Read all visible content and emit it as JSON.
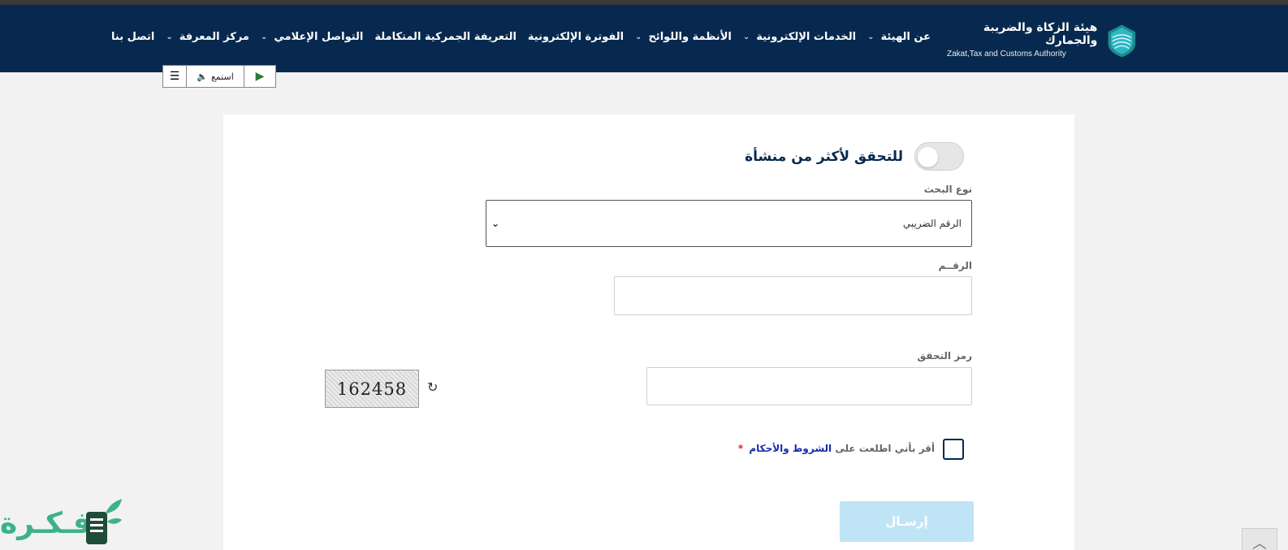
{
  "header": {
    "logo_ar": "هيئة الزكاة والضريبة والجمارك",
    "logo_en": "Zakat,Tax and Customs Authority",
    "nav": [
      {
        "label": "عن الهيئة",
        "has_dropdown": true
      },
      {
        "label": "الخدمات الإلكترونية",
        "has_dropdown": true
      },
      {
        "label": "الأنظمة واللوائح",
        "has_dropdown": true
      },
      {
        "label": "الفوترة الإلكترونية",
        "has_dropdown": false
      },
      {
        "label": "التعريفة الجمركية المتكاملة",
        "has_dropdown": false
      },
      {
        "label": "التواصل الإعلامي",
        "has_dropdown": true
      },
      {
        "label": "مركز المعرفة",
        "has_dropdown": true
      },
      {
        "label": "اتصل بنا",
        "has_dropdown": false
      }
    ],
    "colors": {
      "bg": "#08294f",
      "topstrip": "#3a3a3a"
    }
  },
  "listen_bar": {
    "listen_label": "استمع"
  },
  "form": {
    "toggle_label": "للتحقق لأكثر من منشأة",
    "toggle_on": false,
    "search_type_label": "نوع البحث",
    "search_type_value": "الرقم الضريبي",
    "number_label": "الرقــم",
    "number_value": "",
    "captcha_label": "رمز التحقق",
    "captcha_value": "",
    "captcha_image_text": "162458",
    "terms_prefix": "أقر بأني اطلعت على",
    "terms_link": "الشروط والأحكام",
    "terms_required": "*",
    "submit_label": "إرسـال",
    "colors": {
      "submit_bg": "#bfe4f5",
      "link": "#1a2aa8",
      "required": "#d22222"
    }
  },
  "watermark": {
    "text": "فـكـرة",
    "color": "#3cb28b"
  }
}
